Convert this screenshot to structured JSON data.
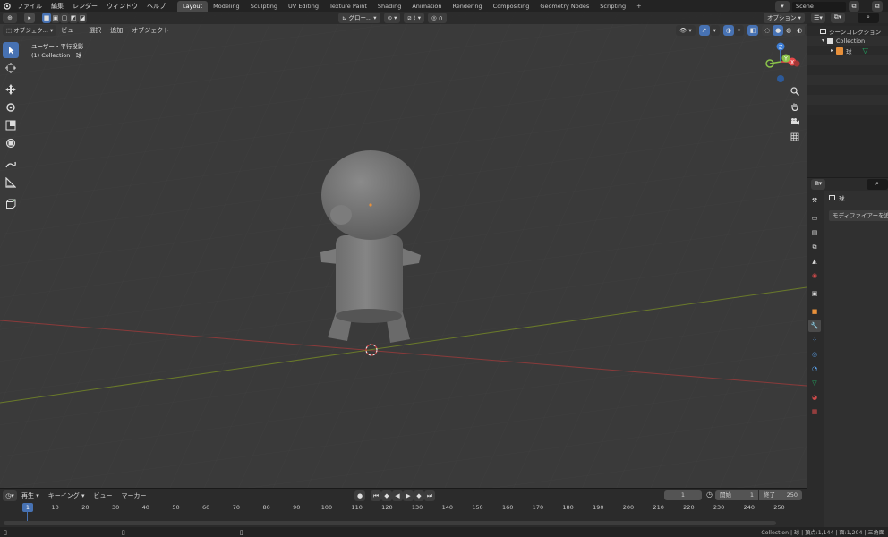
{
  "topbar": {
    "menus": [
      "ファイル",
      "編集",
      "レンダー",
      "ウィンドウ",
      "ヘルプ"
    ],
    "workspaces": [
      "Layout",
      "Modeling",
      "Sculpting",
      "UV Editing",
      "Texture Paint",
      "Shading",
      "Animation",
      "Rendering",
      "Compositing",
      "Geometry Nodes",
      "Scripting"
    ],
    "active_workspace": "Layout",
    "add_tab": "+",
    "scene_name": "Scene"
  },
  "viewport": {
    "mode": "オブジェク...",
    "menus": [
      "ビュー",
      "選択",
      "追加",
      "オブジェクト"
    ],
    "transform_orientation": "グロー...",
    "options_label": "オプション",
    "view_name": "ユーザー・平行投影",
    "collection_info": "(1) Collection | 球",
    "gizmo": {
      "z": "Z",
      "y": "Y",
      "x": "X"
    }
  },
  "outliner": {
    "scene_collection": "シーンコレクション",
    "collection": "Collection",
    "object": "球"
  },
  "properties": {
    "object_name": "球",
    "add_modifier": "モディファイアーを追加"
  },
  "timeline": {
    "menus": [
      "再生",
      "キーイング",
      "ビュー",
      "マーカー"
    ],
    "current_frame": "1",
    "start_label": "開始",
    "start_value": "1",
    "end_label": "終了",
    "end_value": "250",
    "ruler_current": "1",
    "ruler_ticks": [
      "10",
      "20",
      "30",
      "40",
      "50",
      "60",
      "70",
      "80",
      "90",
      "100",
      "110",
      "120",
      "130",
      "140",
      "150",
      "160",
      "170",
      "180",
      "190",
      "200",
      "210",
      "220",
      "230",
      "240",
      "250"
    ]
  },
  "statusbar": {
    "text": "Collection | 球 | 頂点:1,144 | 面:1,204 | 三角面"
  },
  "colors": {
    "accent": "#4772b3",
    "x_axis": "#8a3a3a",
    "y_axis": "#6a7a2a",
    "gizmo_x": "#e8494a",
    "gizmo_y": "#8bc34a",
    "gizmo_z": "#3f7fd6"
  }
}
